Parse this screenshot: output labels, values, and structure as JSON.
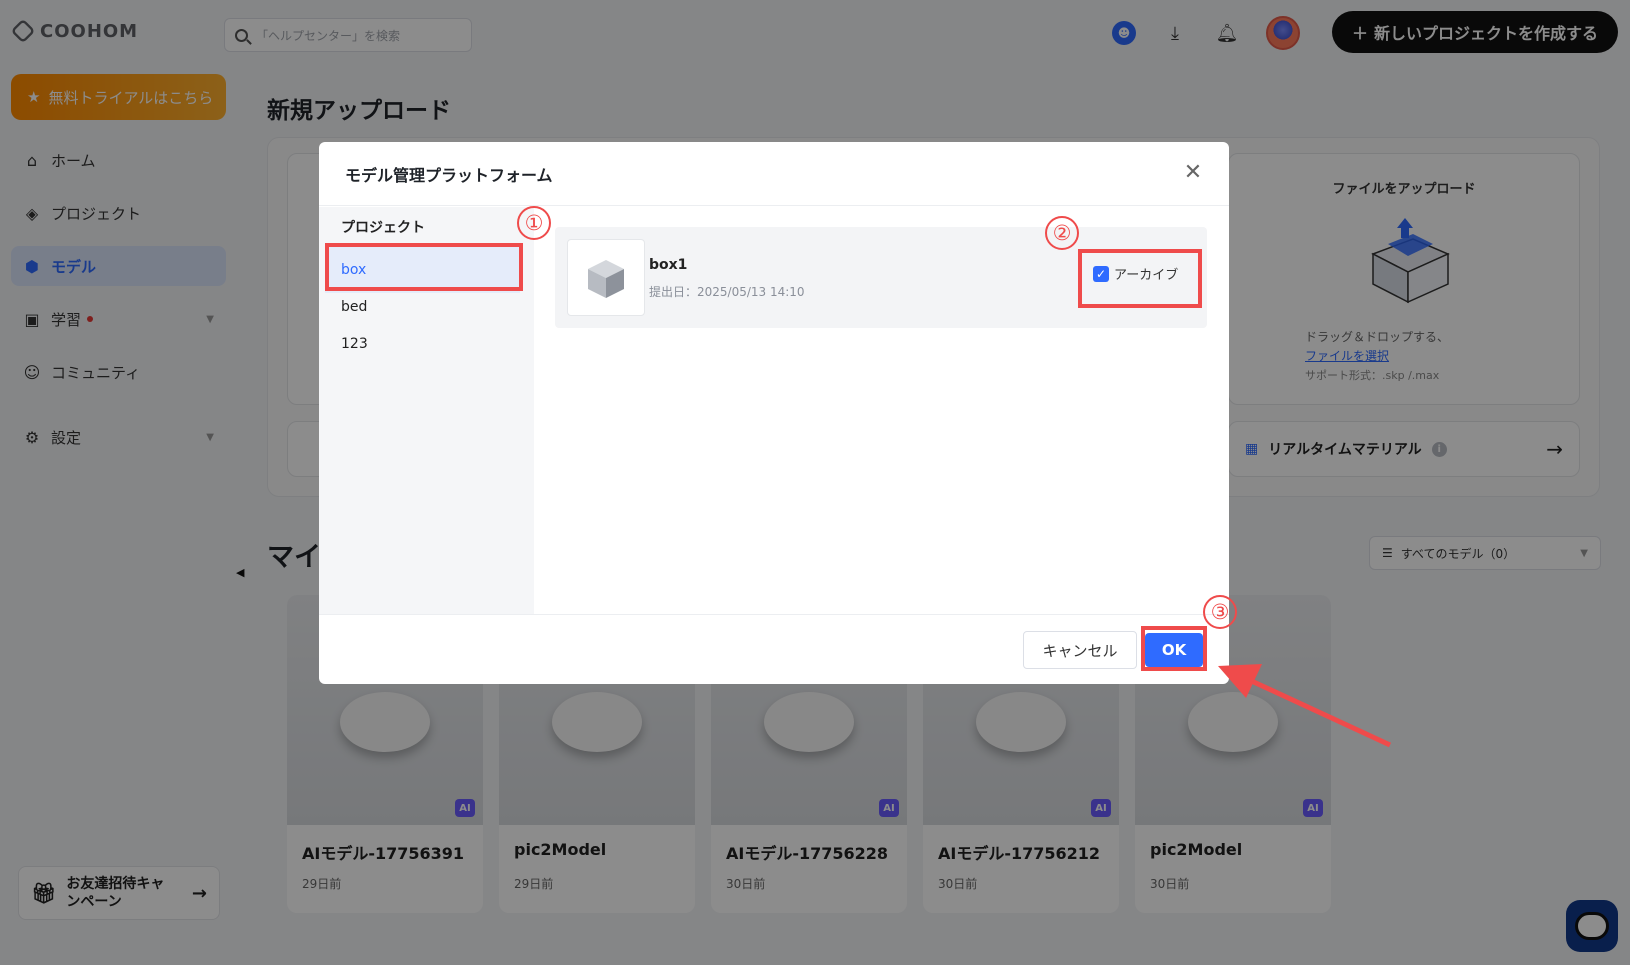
{
  "brand": {
    "name": "COOHOM"
  },
  "header": {
    "search_placeholder": "「ヘルプセンター」を検索",
    "new_project_label": "新しいプロジェクトを作成する"
  },
  "sidebar": {
    "trial_label": "無料トライアルはこちら",
    "items": [
      {
        "label": "ホーム",
        "icon": "home-icon"
      },
      {
        "label": "プロジェクト",
        "icon": "project-icon"
      },
      {
        "label": "モデル",
        "icon": "cube-icon",
        "active": true
      },
      {
        "label": "学習",
        "icon": "monitor-icon"
      },
      {
        "label": "コミュニティ",
        "icon": "people-icon"
      },
      {
        "label": "設定",
        "icon": "settings-icon"
      }
    ],
    "invite_label": "お友達招待キャンペーン"
  },
  "main": {
    "page_title": "新規アップロード",
    "upload": {
      "title": "ファイルをアップロード",
      "hint": "ドラッグ＆ドロップする、",
      "link": "ファイルを選択",
      "formats": "サポート形式：.skp /.max"
    },
    "realtime_label": "リアルタイムマテリアル",
    "section_title": "マイ",
    "filter_label": "すべてのモデル（0）",
    "cards": [
      {
        "name": "AIモデル-17756391",
        "time": "29日前",
        "ai": true
      },
      {
        "name": "pic2Model",
        "time": "29日前",
        "ai": false
      },
      {
        "name": "AIモデル-17756228",
        "time": "30日前",
        "ai": true
      },
      {
        "name": "AIモデル-17756212",
        "time": "30日前",
        "ai": true
      },
      {
        "name": "pic2Model",
        "time": "30日前",
        "ai": true
      }
    ],
    "ai_badge": "AI"
  },
  "modal": {
    "title": "モデル管理プラットフォーム",
    "left_title": "プロジェクト",
    "projects": [
      "box",
      "bed",
      "123"
    ],
    "selected_project": "box",
    "model": {
      "name": "box1",
      "date": "提出日：2025/05/13 14:10",
      "archive_label": "アーカイブ",
      "archive_checked": true
    },
    "cancel_label": "キャンセル",
    "ok_label": "OK"
  },
  "annotations": {
    "step1": "①",
    "step2": "②",
    "step3": "③",
    "color": "#ef4b4b"
  },
  "colors": {
    "accent": "#2f6bff",
    "active_bg": "#dbe6fb",
    "trial_gradient_start": "#ff8a00",
    "annotation_red": "#ef4b4b"
  }
}
